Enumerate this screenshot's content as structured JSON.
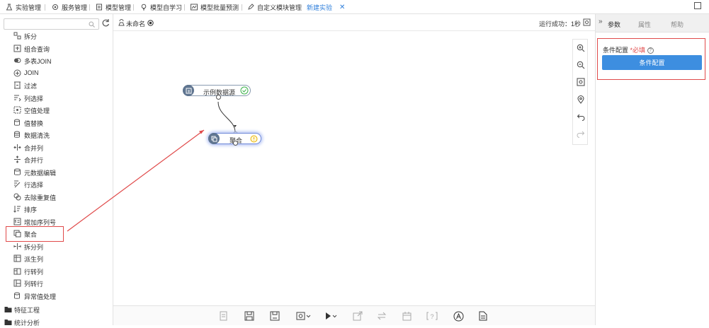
{
  "tabs": [
    {
      "label": "实验管理",
      "icon": "flask-icon"
    },
    {
      "label": "服务管理",
      "icon": "service-icon"
    },
    {
      "label": "模型管理",
      "icon": "model-icon"
    },
    {
      "label": "模型自学习",
      "icon": "bulb-icon"
    },
    {
      "label": "模型批量预测",
      "icon": "chart-icon"
    },
    {
      "label": "自定义模块管理",
      "icon": "edit-icon"
    },
    {
      "label": "新建实验",
      "icon": "",
      "active": true
    }
  ],
  "close_symbol": "✕",
  "search": {
    "placeholder": ""
  },
  "sidebar": {
    "items": [
      {
        "label": "拆分",
        "icon": "split-icon"
      },
      {
        "label": "组合查询",
        "icon": "combine-query-icon"
      },
      {
        "label": "多表JOIN",
        "icon": "multi-join-icon"
      },
      {
        "label": "JOIN",
        "icon": "join-icon"
      },
      {
        "label": "过滤",
        "icon": "filter-icon"
      },
      {
        "label": "列选择",
        "icon": "column-select-icon"
      },
      {
        "label": "空值处理",
        "icon": "null-handle-icon"
      },
      {
        "label": "值替换",
        "icon": "replace-icon"
      },
      {
        "label": "数据清洗",
        "icon": "clean-icon"
      },
      {
        "label": "合并列",
        "icon": "merge-column-icon"
      },
      {
        "label": "合并行",
        "icon": "merge-row-icon"
      },
      {
        "label": "元数据编辑",
        "icon": "metadata-icon"
      },
      {
        "label": "行选择",
        "icon": "row-select-icon"
      },
      {
        "label": "去除重复值",
        "icon": "dedupe-icon"
      },
      {
        "label": "排序",
        "icon": "sort-icon"
      },
      {
        "label": "增加序列号",
        "icon": "serial-icon"
      },
      {
        "label": "聚合",
        "icon": "aggregate-icon"
      },
      {
        "label": "拆分列",
        "icon": "split-column-icon"
      },
      {
        "label": "派生列",
        "icon": "derive-column-icon"
      },
      {
        "label": "行转列",
        "icon": "row-to-column-icon"
      },
      {
        "label": "列转行",
        "icon": "column-to-row-icon"
      },
      {
        "label": "异常值处理",
        "icon": "outlier-icon"
      }
    ],
    "groups": [
      {
        "label": "特征工程",
        "icon": "folder-icon"
      },
      {
        "label": "统计分析",
        "icon": "folder-icon"
      }
    ]
  },
  "canvas": {
    "experiment_name": "未命名",
    "status": "运行成功：1秒",
    "nodes": [
      {
        "label": "示例数据源",
        "state": "success"
      },
      {
        "label": "聚合",
        "state": "warning"
      }
    ]
  },
  "right_panel": {
    "tabs": [
      "参数",
      "属性",
      "帮助"
    ],
    "field_label": "条件配置",
    "required_text": "*必填",
    "help_symbol": "?",
    "button_label": "条件配置"
  },
  "colors": {
    "accent": "#3d8ee0",
    "annotation": "#e04a4a",
    "node": "#5f7590"
  }
}
